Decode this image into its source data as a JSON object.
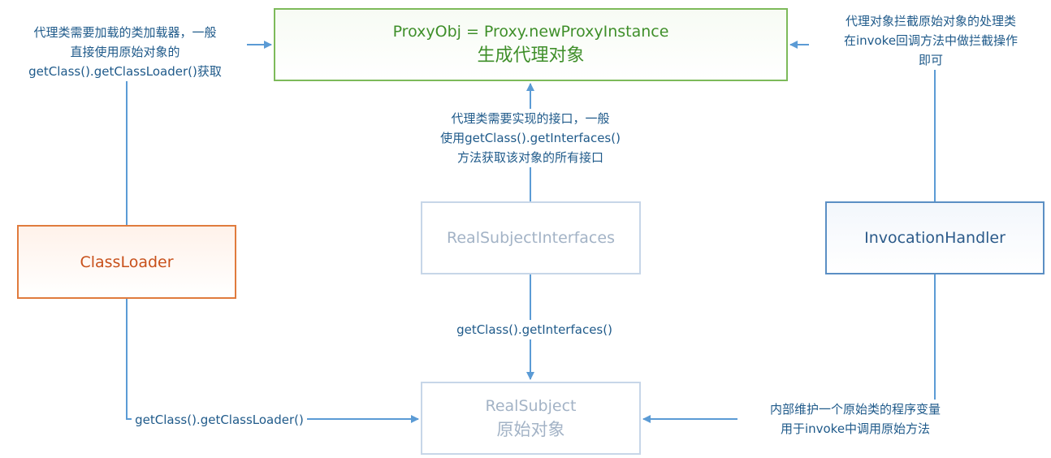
{
  "nodes": {
    "proxy": {
      "line1": "ProxyObj = Proxy.newProxyInstance",
      "line2": "生成代理对象"
    },
    "classloader": {
      "label": "ClassLoader"
    },
    "interfaces": {
      "label": "RealSubjectInterfaces"
    },
    "handler": {
      "label": "InvocationHandler"
    },
    "realsubject": {
      "line1": "RealSubject",
      "line2": "原始对象"
    }
  },
  "edges": {
    "classloader_to_proxy": {
      "lines": [
        "代理类需要加载的类加载器，一般",
        "直接使用原始对象的",
        "getClass().getClassLoader()获取"
      ]
    },
    "handler_to_proxy": {
      "lines": [
        "代理对象拦截原始对象的处理类",
        "在invoke回调方法中做拦截操作",
        "即可"
      ]
    },
    "interfaces_to_proxy": {
      "lines": [
        "代理类需要实现的接口，一般",
        "使用getClass().getInterfaces()",
        "方法获取该对象的所有接口"
      ]
    },
    "interfaces_to_realsubject": {
      "label": "getClass().getInterfaces()"
    },
    "classloader_to_realsubject": {
      "label": "getClass().getClassLoader()"
    },
    "handler_to_realsubject": {
      "lines": [
        "内部维护一个原始类的程序变量",
        "用于invoke中调用原始方法"
      ]
    }
  },
  "colors": {
    "arrow": "#5b9bd5",
    "proxy_border": "#7dba5a",
    "classloader_border": "#e07b3d",
    "interfaces_border": "#c7d6e8",
    "handler_border": "#5b8fc4",
    "label_text": "#1f5a8a"
  }
}
